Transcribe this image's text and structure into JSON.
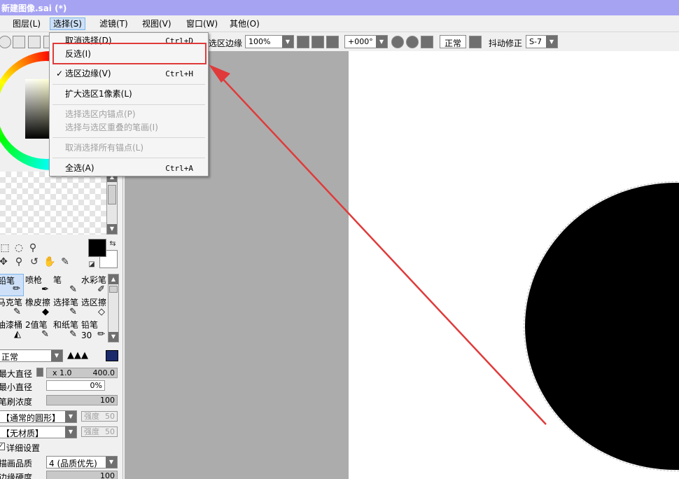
{
  "window": {
    "title": "新建图像.sai (*)"
  },
  "menubar": {
    "items": [
      "图层(L)",
      "选择(S)",
      "滤镜(T)",
      "视图(V)",
      "窗口(W)",
      "其他(O)"
    ]
  },
  "toolbar": {
    "selection_edge_label": "选区边缘",
    "zoom": "100%",
    "rotation": "+000°",
    "blend_mode": "正常",
    "stabilizer_label": "抖动修正",
    "stabilizer_value": "S-7"
  },
  "dropdown": {
    "items": [
      {
        "label": "取消选择(D)",
        "shortcut": "Ctrl+D",
        "enabled": true
      },
      {
        "label": "反选(I)",
        "shortcut": "",
        "enabled": true
      },
      {
        "label": "选区边缘(V)",
        "shortcut": "Ctrl+H",
        "enabled": true,
        "checked": true
      },
      {
        "label": "扩大选区1像素(L)",
        "shortcut": "",
        "enabled": true
      },
      {
        "label": "选择选区内锚点(P)",
        "shortcut": "",
        "enabled": false
      },
      {
        "label": "选择与选区重叠的笔画(I)",
        "shortcut": "",
        "enabled": false
      },
      {
        "label": "取消选择所有锚点(L)",
        "shortcut": "",
        "enabled": false
      },
      {
        "label": "全选(A)",
        "shortcut": "Ctrl+A",
        "enabled": true
      }
    ]
  },
  "brushes": {
    "row1": [
      "铅笔",
      "喷枪",
      "笔",
      "水彩笔"
    ],
    "row2": [
      "马克笔",
      "橡皮擦",
      "选择笔",
      "选区擦"
    ],
    "row3": [
      "油漆桶",
      "2值笔",
      "和纸笔",
      "铅笔30"
    ]
  },
  "brush_settings": {
    "mode": "正常",
    "max_size_label": "最大直径",
    "max_size_multiplier": "x 1.0",
    "max_size_value": "400.0",
    "min_size_label": "最小直径",
    "min_size_value": "0%",
    "density_label": "笔刷浓度",
    "density_value": "100",
    "shape": "【通常的圆形】",
    "shape_strength_label": "强度",
    "shape_strength_value": "50",
    "texture": "【无材质】",
    "texture_strength_label": "强度",
    "texture_strength_value": "50",
    "advanced_label": "详细设置",
    "quality_label": "描画品质",
    "quality_value": "4 (品质优先)",
    "edge_hardness_label": "边缘硬度",
    "edge_hardness_value": "100"
  },
  "colors": {
    "title_bar": "#a7a3f3",
    "highlight_red": "#e03a3a",
    "canvas_grey": "#acacac",
    "foreground": "#000000",
    "background": "#ffffff"
  }
}
